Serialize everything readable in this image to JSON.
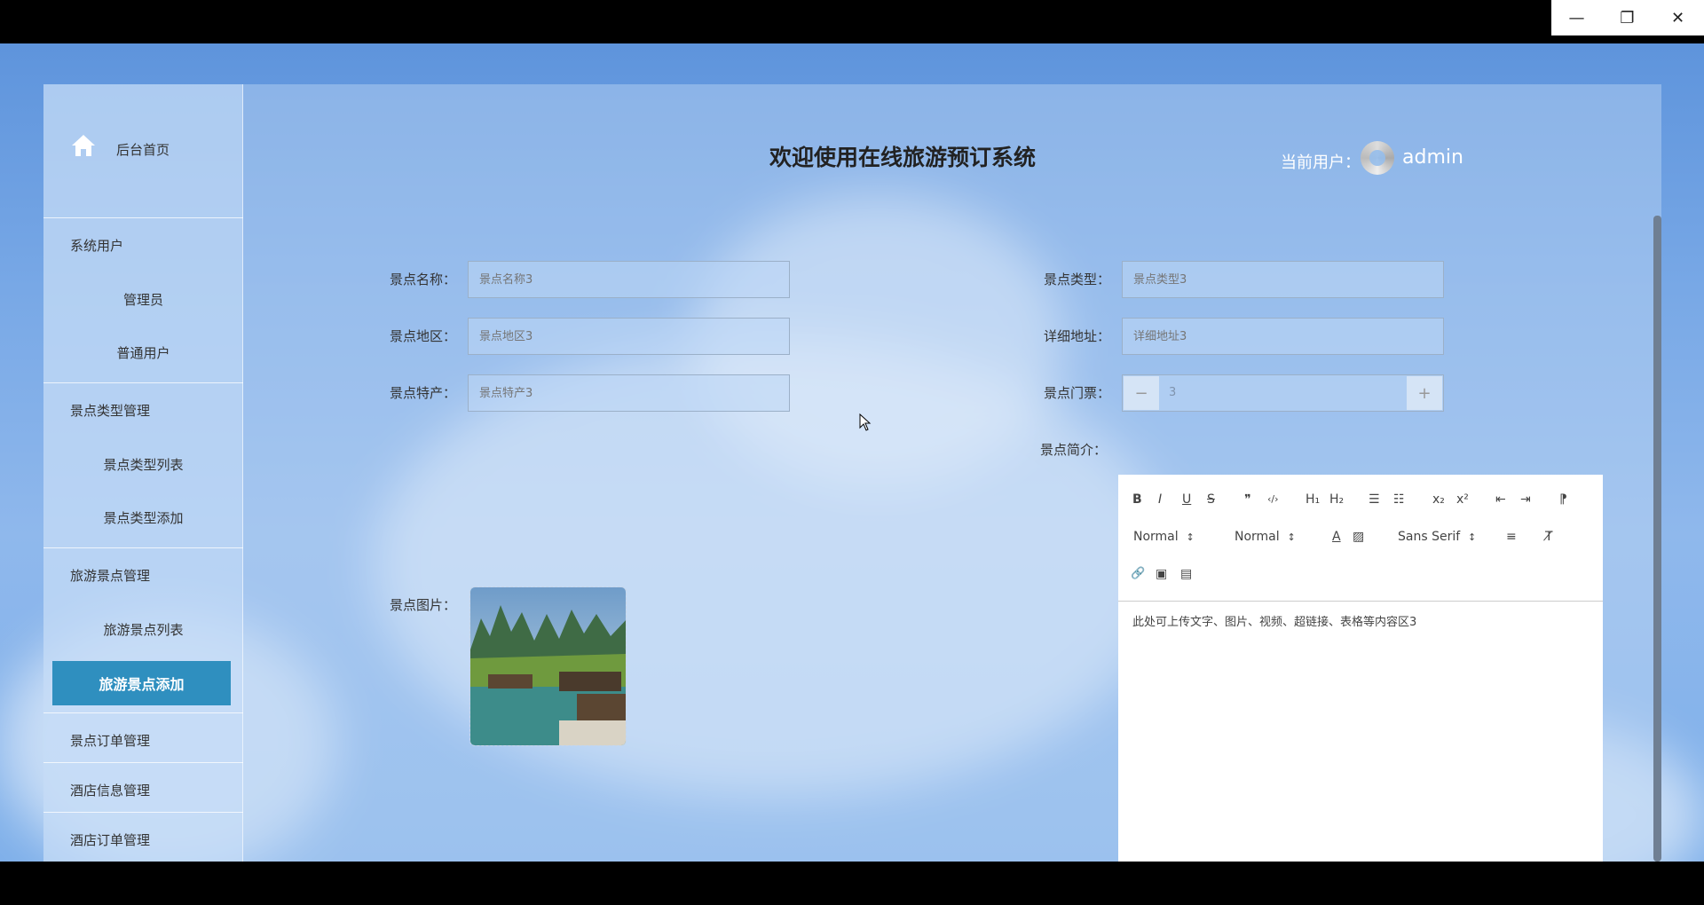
{
  "window": {
    "minimize": "—",
    "restore": "❐",
    "close": "✕"
  },
  "header": {
    "title": "欢迎使用在线旅游预订系统",
    "current_user_label": "当前用户：",
    "username": "admin"
  },
  "sidebar": {
    "home": "后台首页",
    "groups": [
      {
        "title": "系统用户",
        "items": [
          "管理员",
          "普通用户"
        ]
      },
      {
        "title": "景点类型管理",
        "items": [
          "景点类型列表",
          "景点类型添加"
        ]
      },
      {
        "title": "旅游景点管理",
        "items": [
          "旅游景点列表",
          "旅游景点添加"
        ]
      },
      {
        "title": "景点订单管理"
      },
      {
        "title": "酒店信息管理"
      },
      {
        "title": "酒店订单管理"
      }
    ],
    "active_item": "旅游景点添加"
  },
  "form": {
    "name": {
      "label": "景点名称：",
      "placeholder": "景点名称3"
    },
    "type": {
      "label": "景点类型：",
      "placeholder": "景点类型3"
    },
    "region": {
      "label": "景点地区：",
      "placeholder": "景点地区3"
    },
    "address": {
      "label": "详细地址：",
      "placeholder": "详细地址3"
    },
    "specialty": {
      "label": "景点特产：",
      "placeholder": "景点特产3"
    },
    "ticket": {
      "label": "景点门票：",
      "value": "3",
      "minus": "−",
      "plus": "+"
    },
    "intro": {
      "label": "景点简介："
    },
    "image": {
      "label": "景点图片："
    }
  },
  "editor": {
    "toolbar": {
      "bold": "B",
      "italic": "I",
      "underline": "U",
      "strike": "S",
      "quote": "❞",
      "code": "‹/›",
      "h1": "H₁",
      "h2": "H₂",
      "ordered": "☰",
      "bullet": "☷",
      "sub": "x₂",
      "sup": "x²",
      "outdent": "⇤",
      "indent": "⇥",
      "rtl": "⁋",
      "size": "Normal",
      "header": "Normal",
      "font": "Sans Serif",
      "color": "A",
      "bg": "▨",
      "align": "≡",
      "clean": "T̸",
      "link": "🔗",
      "image": "▣",
      "video": "▤"
    },
    "content": "此处可上传文字、图片、视频、超链接、表格等内容区3"
  }
}
